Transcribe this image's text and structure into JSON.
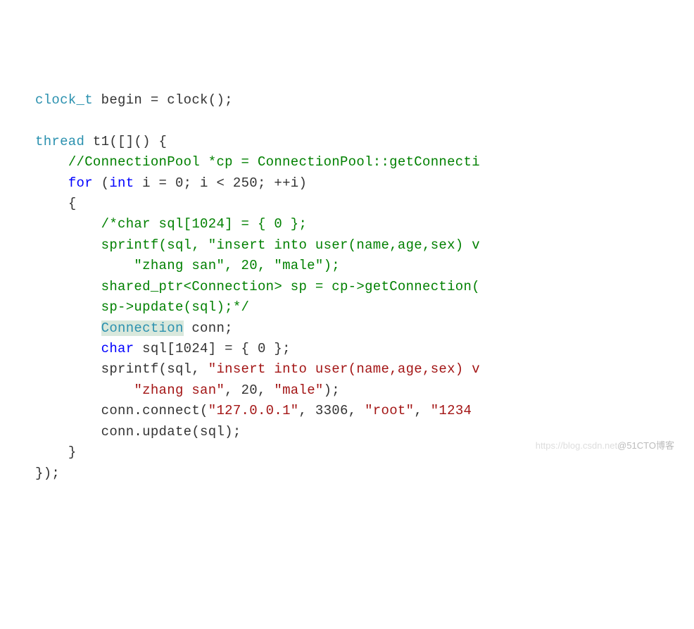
{
  "line1": {
    "type": "clock_t",
    "var": "begin",
    "eq": "=",
    "call": "clock();"
  },
  "line3": {
    "type": "thread",
    "rest": "t1([]() {"
  },
  "line4_comment": "//ConnectionPool *cp = ConnectionPool::getConnecti",
  "for_kw": "for",
  "for_paren_open": "(",
  "int_kw": "int",
  "for_init": "i = 0; i < 250; ++i)",
  "brace_open": "{",
  "c1": "/*char sql[1024] = { 0 };",
  "c2": "sprintf(sql, \"insert into user(name,age,sex) v",
  "c3": "    \"zhang san\", 20, \"male\");",
  "c4": "shared_ptr<Connection> sp = cp->getConnection(",
  "c5": "sp->update(sql);*/",
  "conn_type": "Connection",
  "conn_decl": " conn;",
  "char_kw": "char",
  "sql_decl": " sql[1024] = { 0 };",
  "sprintf_name": "sprintf(sql, ",
  "str1": "\"insert into user(name,age,sex) v",
  "sprintf_cont_indent": "    ",
  "str2": "\"zhang san\"",
  "comma_20": ", 20, ",
  "str3": "\"male\"",
  "paren_end": ");",
  "connect_call": "conn.connect(",
  "ip": "\"127.0.0.1\"",
  "port_seg": ", 3306, ",
  "root": "\"root\"",
  "comma2": ", ",
  "pwd": "\"1234",
  "update_call": "conn.update(sql);",
  "brace_close_inner": "}",
  "brace_close_outer": "});",
  "watermark_light": "https://blog.csdn.net",
  "watermark_dark": "@51CTO博客"
}
